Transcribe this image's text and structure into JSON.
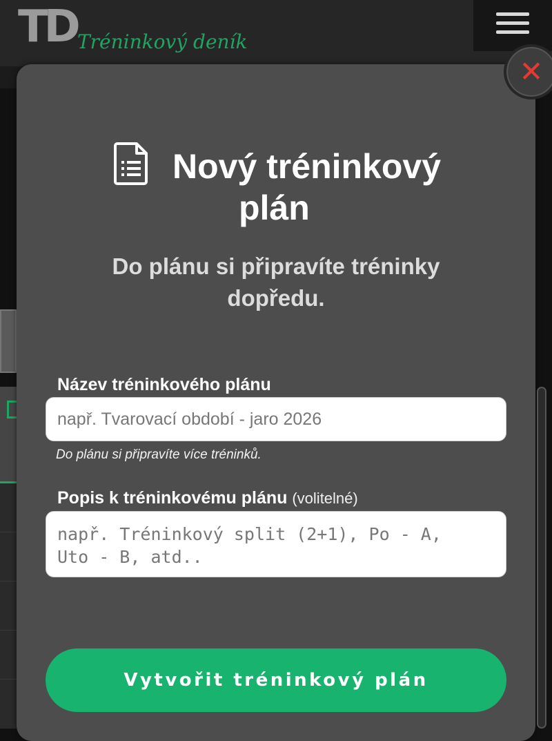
{
  "app": {
    "logo_mark": "TD",
    "logo_text": "Tréninkový deník"
  },
  "modal": {
    "close_symbol": "✕",
    "title_line1": "Nový tréninkový",
    "title_line2": "plán",
    "subtitle": "Do plánu si připravíte tréninky dopředu.",
    "name_field": {
      "label": "Název tréninkového plánu",
      "placeholder": "např. Tvarovací období - jaro 2026",
      "hint": "Do plánu si připravíte více tréninků."
    },
    "description_field": {
      "label": "Popis k tréninkovému plánu",
      "optional_label": "(volitelné)",
      "placeholder": "např. Tréninkový split (2+1), Po - A,\nUto - B, atd.."
    },
    "submit_label": "Vytvořit tréninkový plán"
  },
  "icons": {
    "document": "document-list-icon",
    "close": "close-icon",
    "menu": "hamburger-menu-icon"
  },
  "colors": {
    "accent": "#18b46f",
    "brand_text": "#1fa463",
    "close": "#e53935",
    "modal_bg": "#4d4d4d"
  }
}
